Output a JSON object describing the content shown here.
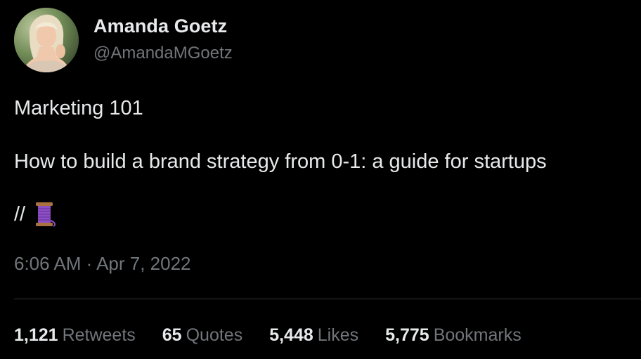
{
  "author": {
    "name": "Amanda Goetz",
    "handle": "@AmandaMGoetz"
  },
  "tweet": {
    "line1": "Marketing 101",
    "line2": "How to build a brand strategy from 0-1: a guide for startups",
    "line3_text": "//",
    "line3_emoji_icon": "thread-spool-icon",
    "timestamp": "6:06 AM · Apr 7, 2022"
  },
  "stats": [
    {
      "count": "1,121",
      "label": "Retweets"
    },
    {
      "count": "65",
      "label": "Quotes"
    },
    {
      "count": "5,448",
      "label": "Likes"
    },
    {
      "count": "5,775",
      "label": "Bookmarks"
    }
  ],
  "colors": {
    "background": "#000000",
    "primary_text": "#e7e9ea",
    "secondary_text": "#71767b",
    "divider": "#2f3336",
    "spool_thread": "#8e4fc4"
  }
}
